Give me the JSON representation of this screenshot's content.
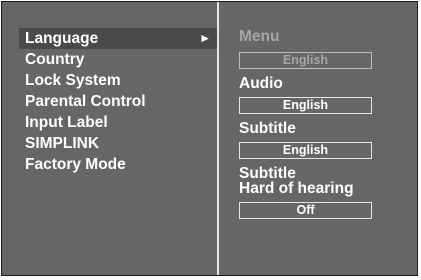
{
  "left_menu": {
    "items": [
      {
        "label": "Language",
        "selected": true
      },
      {
        "label": "Country"
      },
      {
        "label": "Lock System"
      },
      {
        "label": "Parental Control"
      },
      {
        "label": "Input Label"
      },
      {
        "label": "SIMPLINK"
      },
      {
        "label": "Factory Mode"
      }
    ],
    "arrow_icon": "►"
  },
  "language_settings": {
    "menu": {
      "label": "Menu",
      "value": "English"
    },
    "audio": {
      "label": "Audio",
      "value": "English"
    },
    "subtitle": {
      "label": "Subtitle",
      "value": "English"
    },
    "subtitle_hoh": {
      "label_line1": "Subtitle",
      "label_line2": "Hard of hearing",
      "value": "Off"
    }
  },
  "colors": {
    "panel_bg": "#666666",
    "selected_bg": "#4a4a4a",
    "text": "#ffffff",
    "disabled_text": "#a6a6a6",
    "divider": "#e6e6e6"
  }
}
